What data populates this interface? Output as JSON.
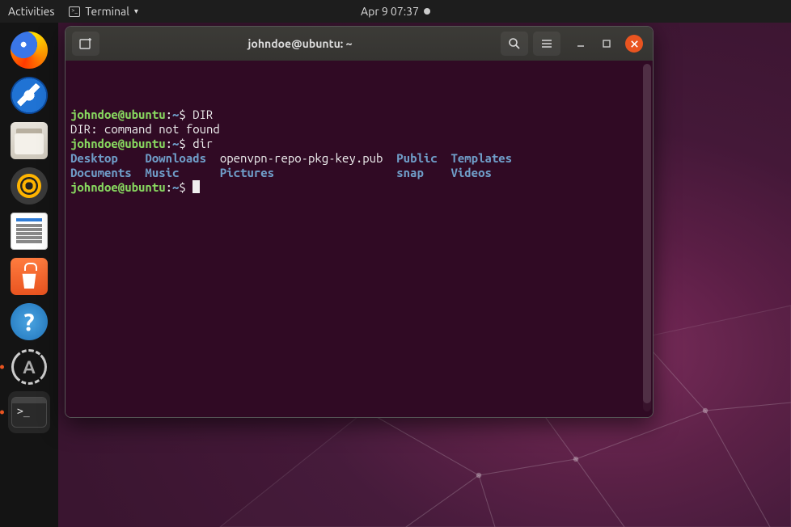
{
  "topbar": {
    "activities": "Activities",
    "app_label": "Terminal",
    "datetime": "Apr 9  07:37"
  },
  "dock": {
    "items": [
      {
        "name": "firefox",
        "label": "Firefox"
      },
      {
        "name": "thunderbird",
        "label": "Thunderbird"
      },
      {
        "name": "files",
        "label": "Files"
      },
      {
        "name": "rhythmbox",
        "label": "Rhythmbox"
      },
      {
        "name": "writer",
        "label": "LibreOffice Writer"
      },
      {
        "name": "software",
        "label": "Ubuntu Software"
      },
      {
        "name": "help",
        "label": "Help"
      },
      {
        "name": "updater",
        "label": "Software Updater"
      },
      {
        "name": "terminal",
        "label": "Terminal"
      }
    ]
  },
  "terminal": {
    "title": "johndoe@ubuntu: ~",
    "prompt": {
      "userhost": "johndoe@ubuntu",
      "sep": ":",
      "path": "~",
      "symbol": "$"
    },
    "lines": [
      {
        "type": "prompt",
        "cmd": "DIR"
      },
      {
        "type": "out",
        "text": "DIR: command not found"
      },
      {
        "type": "prompt",
        "cmd": "dir"
      },
      {
        "type": "dir_row",
        "cells": [
          {
            "text": "Desktop",
            "color": "blue",
            "pad": 11
          },
          {
            "text": "Downloads",
            "color": "blue",
            "pad": 11
          },
          {
            "text": "openvpn-repo-pkg-key.pub",
            "color": "white",
            "pad": 26
          },
          {
            "text": "Public",
            "color": "blue",
            "pad": 8
          },
          {
            "text": "Templates",
            "color": "blue",
            "pad": 0
          }
        ]
      },
      {
        "type": "dir_row",
        "cells": [
          {
            "text": "Documents",
            "color": "blue",
            "pad": 11
          },
          {
            "text": "Music",
            "color": "blue",
            "pad": 11
          },
          {
            "text": "Pictures",
            "color": "blue",
            "pad": 26
          },
          {
            "text": "snap",
            "color": "blue",
            "pad": 8
          },
          {
            "text": "Videos",
            "color": "blue",
            "pad": 0
          }
        ]
      },
      {
        "type": "prompt",
        "cmd": "",
        "cursor": true
      }
    ]
  }
}
